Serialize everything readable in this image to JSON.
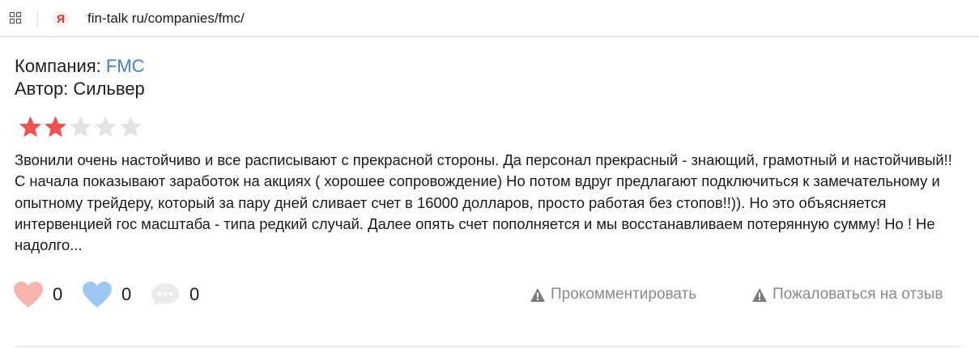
{
  "browser": {
    "url": "fin-talk ru/companies/fmc/",
    "tabs_icon": "tabs-grid-icon",
    "favicon": "yandex-favicon-icon",
    "favicon_letter": "Я"
  },
  "review": {
    "company_label": "Компания: ",
    "company_name": "FMC",
    "author_label": "Автор: ",
    "author_name": "Сильвер",
    "rating": 2,
    "rating_max": 5,
    "text": "Звонили очень настойчиво и все расписывают с прекрасной стороны. Да персонал прекрасный - знающий, грамотный и настойчивый!! С начала показывают заработок на акциях ( хорошее сопровождение) Но потом вдруг предлагают подключиться к замечательному и опытному трейдеру, который за пару дней сливает счет в 16000 долларов, просто работая без стопов!!)). Но это объясняется интервенцией гос масштаба - типа редкий случай. Далее опять счет пополняется и мы восстанавливаем потерянную сумму! Но ! Не надолго..."
  },
  "reactions": {
    "likes": {
      "icon": "heart-pink-icon",
      "count": "0"
    },
    "hearts": {
      "icon": "heart-blue-icon",
      "count": "0"
    },
    "comments": {
      "icon": "comment-bubble-icon",
      "count": "0"
    }
  },
  "actions": {
    "comment_label": "Прокомментировать",
    "complain_label": "Пожаловаться на отзыв",
    "icon": "warning-triangle-icon"
  },
  "colors": {
    "link": "#3c7fd6",
    "star_filled": "#f0524f",
    "star_empty": "#e3e3e3",
    "heart_pink": "#f7b3ad",
    "heart_blue": "#9ec7f4",
    "comment_gray": "#e6e6e6",
    "muted_text": "#8a8a8a"
  }
}
